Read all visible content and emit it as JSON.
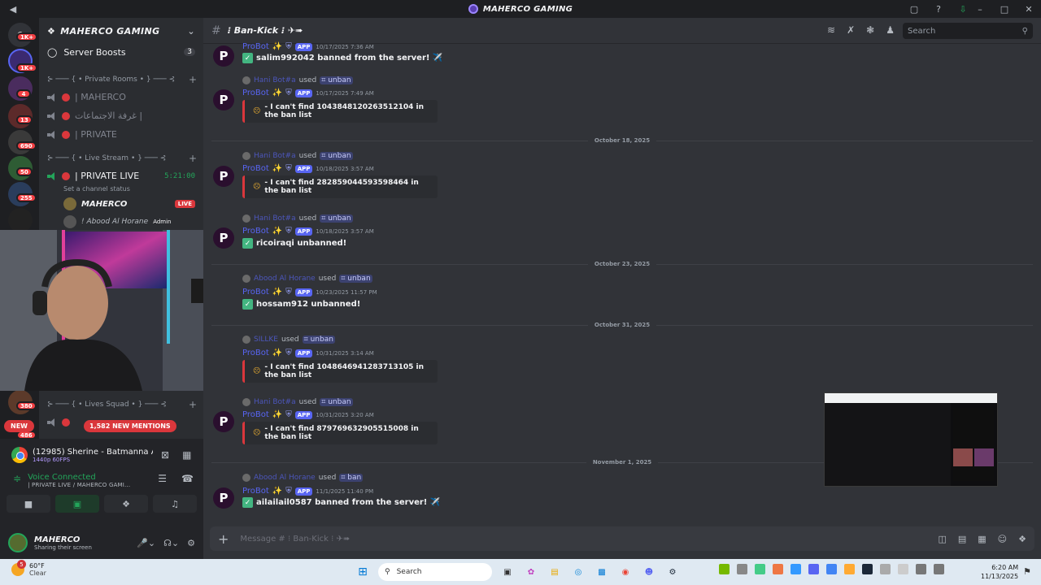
{
  "window": {
    "title": "MAHERCO GAMING"
  },
  "rail": {
    "badges": [
      "1K+",
      "1K+",
      "4",
      "13",
      "690",
      "50",
      "255",
      "380",
      "486"
    ],
    "new_pill": "NEW",
    "mentions": "1,582 NEW MENTIONS"
  },
  "sidebar": {
    "guild_name": "MAHERCO GAMING",
    "boosts_label": "Server Boosts",
    "boosts_count": "3",
    "categories": [
      "⊱ ─── { • Private Rooms • } ─── ⊰",
      "⊱ ─── { • Live Stream • } ─── ⊰",
      "⊱ ─── { • Lives Squad • } ─── ⊰"
    ],
    "private_channels": [
      "| MAHERCO",
      "غرفة الاجتماعات |",
      "| PRIVATE"
    ],
    "live_channel": {
      "name": "| PRIVATE LIVE",
      "timer": "5:21:00",
      "status": "Set a channel status"
    },
    "live_users": [
      {
        "name": "MAHERCO",
        "badge": "LIVE"
      },
      {
        "name": "! Abood Al Horane",
        "badge": "Admin"
      }
    ]
  },
  "panel": {
    "stream_title": "(12985) Sherine - Batmanna A...",
    "stream_quality": "1440p 60FPS",
    "voice_status": "Voice Connected",
    "voice_channel": "| PRIVATE LIVE / MAHERCO GAMI...",
    "user_name": "MAHERCO",
    "user_status": "Sharing their screen"
  },
  "chat": {
    "channel_name": "⁝ Ban-Kick ⁝ ✈➠",
    "search_placeholder": "Search",
    "composer_placeholder": "Message # ⁝ Ban-Kick ⁝ ✈➠",
    "app_tag": "APP",
    "used_word": "used",
    "messages": [
      {
        "bot": "ProBot",
        "time": "10/17/2025 7:36 AM",
        "text": "salim992042 banned from the server! ✈️"
      },
      {
        "reply_user": "Hani Bot#a",
        "cmd": "⌗ unban",
        "bot": "ProBot",
        "time": "10/17/2025 7:49 AM",
        "embed": "- I can't find 1043848120263512104 in the ban list"
      },
      {
        "reply_user": "Hani Bot#a",
        "cmd": "⌗ unban",
        "bot": "ProBot",
        "time": "10/18/2025 3:57 AM",
        "embed": "- I can't find 282859044593598464 in the ban list"
      },
      {
        "reply_user": "Hani Bot#a",
        "cmd": "⌗ unban",
        "bot": "ProBot",
        "time": "10/18/2025 3:57 AM",
        "text": "ricoiraqi unbanned!"
      },
      {
        "reply_user": "Abood Al Horane",
        "cmd": "⌗ unban",
        "bot": "ProBot",
        "time": "10/23/2025 11:57 PM",
        "text": "hossam912 unbanned!"
      },
      {
        "reply_user": "SILLKE",
        "cmd": "⌗ unban",
        "bot": "ProBot",
        "time": "10/31/2025 3:14 AM",
        "embed": "- I can't find 1048646941283713105 in the ban list"
      },
      {
        "reply_user": "Hani Bot#a",
        "cmd": "⌗ unban",
        "bot": "ProBot",
        "time": "10/31/2025 3:20 AM",
        "embed": "- I can't find 879769632905515008 in the ban list"
      },
      {
        "reply_user": "Abood Al Horane",
        "cmd": "⌗ ban",
        "bot": "ProBot",
        "time": "11/1/2025 11:40 PM",
        "text": "ailailail0587 banned from the server! ✈️"
      }
    ],
    "dividers": [
      "October 18, 2025",
      "October 23, 2025",
      "October 31, 2025",
      "November 1, 2025"
    ]
  },
  "taskbar": {
    "weather_temp": "60°F",
    "weather_desc": "Clear",
    "weather_badge": "5",
    "search": "Search",
    "time": "6:20 AM",
    "date": "11/13/2025"
  },
  "colors": {
    "accent": "#5865f2",
    "live": "#da373c",
    "connected": "#23a55a",
    "bg": "#313338"
  }
}
